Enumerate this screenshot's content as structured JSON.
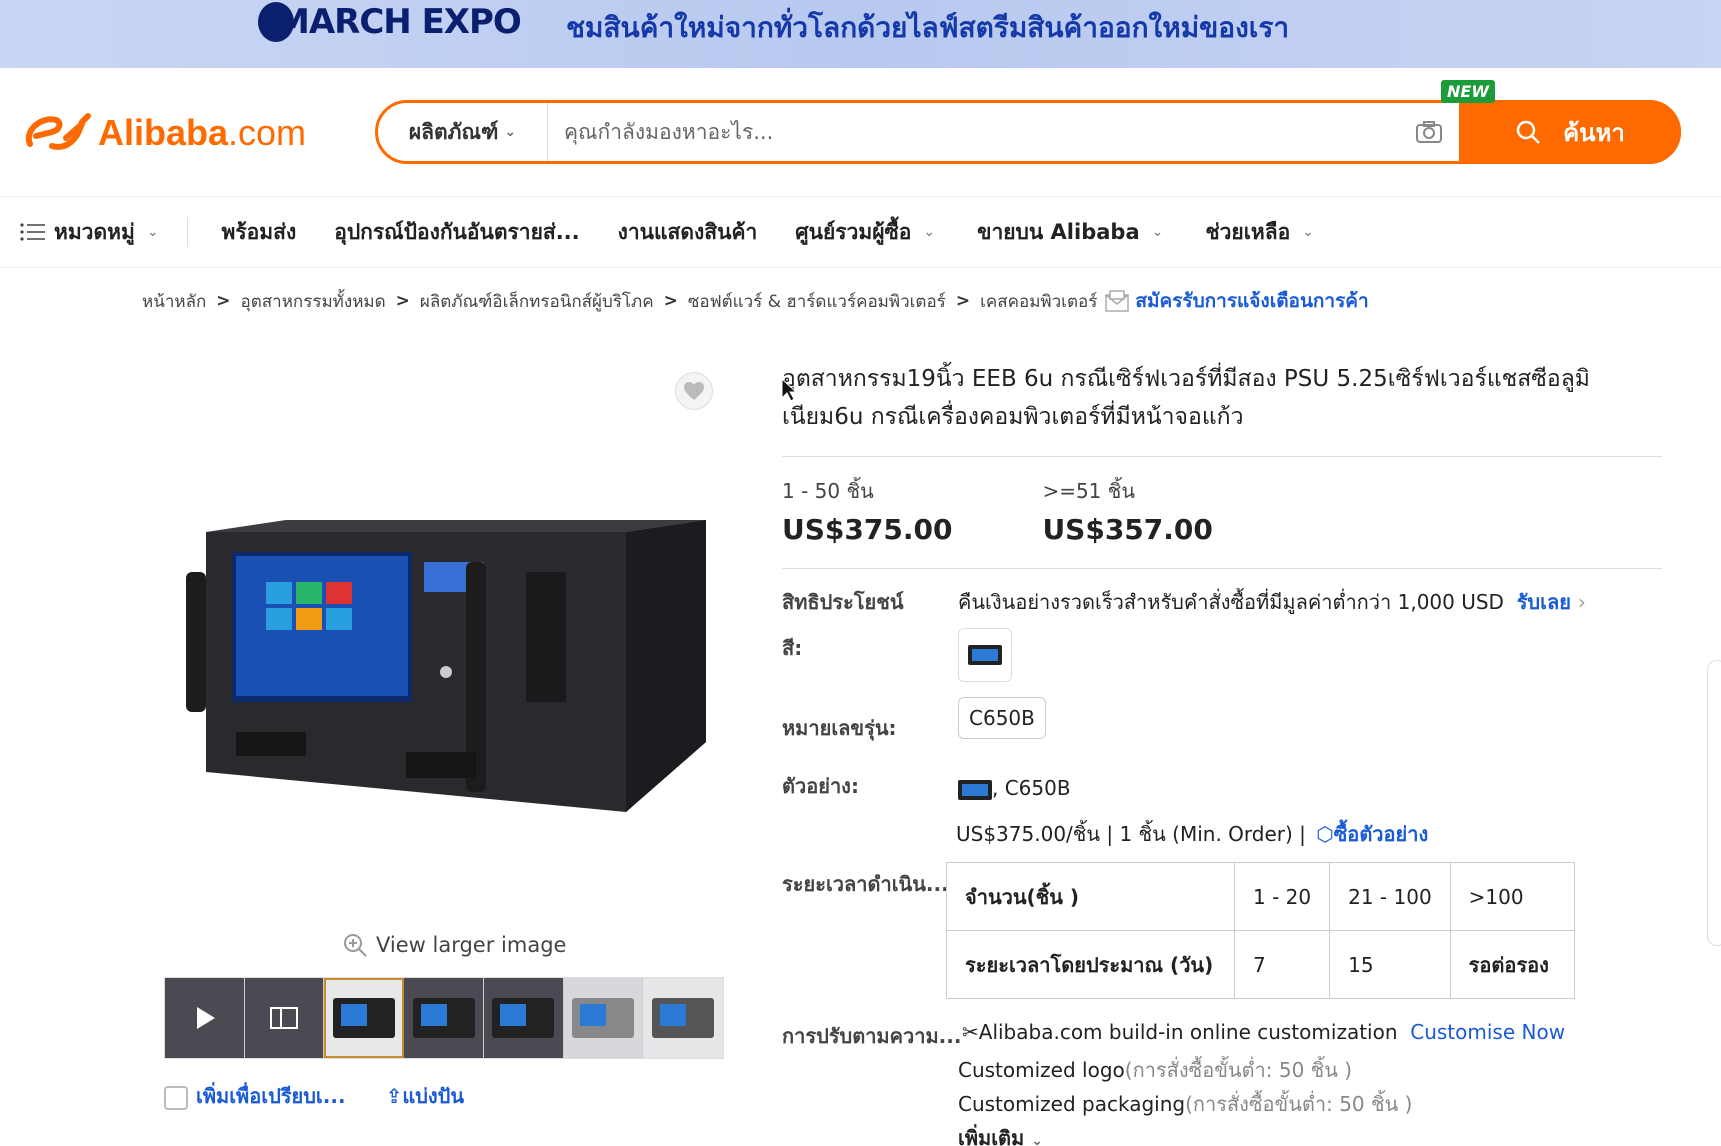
{
  "banner": {
    "brand": "MARCH EXPO",
    "tagline": "ชมสินค้าใหม่จากทั่วโลกด้วยไลฟ์สตรีมสินค้าออกใหม่ของเรา"
  },
  "header": {
    "brand_main": "Alibaba",
    "brand_suffix": ".com",
    "search_category": "ผลิตภัณฑ์",
    "search_placeholder": "คุณกำลังมองหาอะไร...",
    "new_badge": "NEW",
    "search_button": "ค้นหา"
  },
  "nav": {
    "items": [
      {
        "label": "หมวดหมู่"
      },
      {
        "label": "พร้อมส่ง"
      },
      {
        "label": "อุปกรณ์ป้องกันอันตรายส่..."
      },
      {
        "label": "งานแสดงสินค้า"
      },
      {
        "label": "ศูนย์รวมผู้ซื้อ"
      },
      {
        "label": "ขายบน Alibaba"
      },
      {
        "label": "ช่วยเหลือ"
      }
    ]
  },
  "breadcrumb": {
    "items": [
      "หน้าหลัก",
      "อุตสาหกรรมทั้งหมด",
      "ผลิตภัณฑ์อิเล็กทรอนิกส์ผู้บริโภค",
      "ซอฟต์แวร์ & ฮาร์ดแวร์คอมพิวเตอร์",
      "เคสคอมพิวเตอร์"
    ],
    "separator": ">",
    "subscribe": "สมัครรับการแจ้งเตือนการค้า"
  },
  "gallery": {
    "view_larger": "View larger image",
    "compare": "เพิ่มเพื่อเปรียบเ...",
    "share": "แบ่งปัน"
  },
  "product": {
    "title": "อุตสาหกรรม19นิ้ว EEB 6u กรณีเซิร์ฟเวอร์ที่มีสอง PSU 5.25เซิร์ฟเวอร์แชสซีอลูมิเนียม6u กรณีเครื่องคอมพิวเตอร์ที่มีหน้าจอแก้ว",
    "price_tiers": [
      {
        "qty": "1 - 50 ชิ้น",
        "price": "US$375.00"
      },
      {
        "qty": ">=51 ชิ้น",
        "price": "US$357.00"
      }
    ],
    "benefits_label": "สิทธิประโยชน์",
    "benefits_text": "คืนเงินอย่างรวดเร็วสำหรับคำสั่งซื้อที่มีมูลค่าต่ำกว่า 1,000 USD",
    "benefits_link": "รับเลย",
    "color_label": "สี:",
    "model_label": "หมายเลขรุ่น:",
    "model_value": "C650B",
    "sample_label": "ตัวอย่าง:",
    "sample_value": ", C650B",
    "sample_price": "US$375.00/ชิ้น | 1 ชิ้น (Min. Order) |",
    "sample_link": "ซื้อตัวอย่าง",
    "lead_label": "ระยะเวลาดำเนิน...",
    "lead_table": {
      "header": [
        "จำนวน(ชิ้น )",
        "1 - 20",
        "21 - 100",
        ">100"
      ],
      "row": [
        "ระยะเวลาโดยประมาณ (วัน)",
        "7",
        "15",
        "รอต่อรอง"
      ]
    },
    "custom_label": "การปรับตามความ...",
    "custom_text": "Alibaba.com build-in online customization",
    "custom_link": "Customise Now",
    "custom_logo": "Customized logo",
    "custom_logo_note": "(การสั่งซื้อขั้นต่ำ: 50 ชิ้น )",
    "custom_pack": "Customized packaging",
    "custom_pack_note": "(การสั่งซื้อขั้นต่ำ: 50 ชิ้น )",
    "more": "เพิ่มเติม"
  },
  "colors": {
    "accent": "#ff6a00",
    "link": "#1a5ad7",
    "new_badge": "#1a9c3a"
  }
}
